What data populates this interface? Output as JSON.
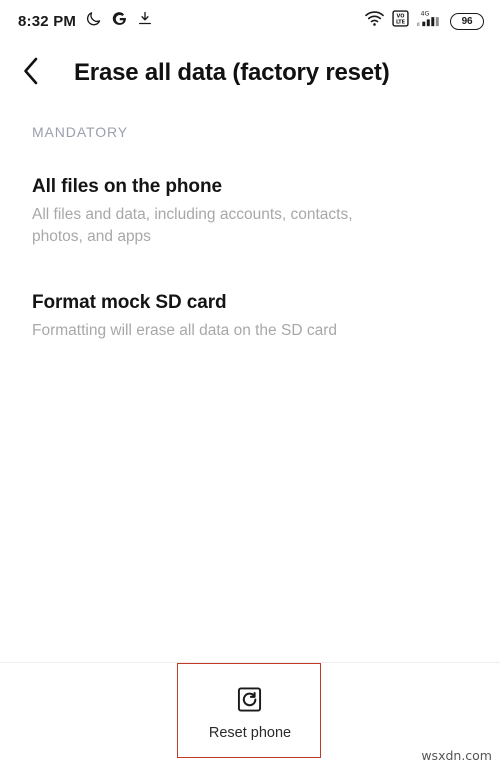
{
  "statusbar": {
    "time": "8:32 PM",
    "left_icons": [
      {
        "name": "moon-icon",
        "glyph": "moon"
      },
      {
        "name": "google-icon",
        "glyph": "G"
      },
      {
        "name": "download-icon",
        "glyph": "download"
      }
    ],
    "wifi_icon": "wifi-icon",
    "volte_icon": "volte-icon",
    "volte_label": "VO LTE",
    "network_type": "4G",
    "signal_icon": "signal-bars-icon",
    "battery_percent": "96"
  },
  "appbar": {
    "back_icon": "back-chevron-icon",
    "title": "Erase all data (factory reset)"
  },
  "main": {
    "section_header": "MANDATORY",
    "items": [
      {
        "title": "All files on the phone",
        "subtitle": "All files and data, including accounts, contacts, photos, and apps"
      },
      {
        "title": "Format mock SD card",
        "subtitle": "Formatting will erase all data on the SD card"
      }
    ]
  },
  "bottom": {
    "reset_icon": "reset-phone-icon",
    "reset_label": "Reset phone"
  },
  "annotation": {
    "highlight_color": "#c0392b"
  },
  "watermark": {
    "text": "wsxdn.com"
  }
}
